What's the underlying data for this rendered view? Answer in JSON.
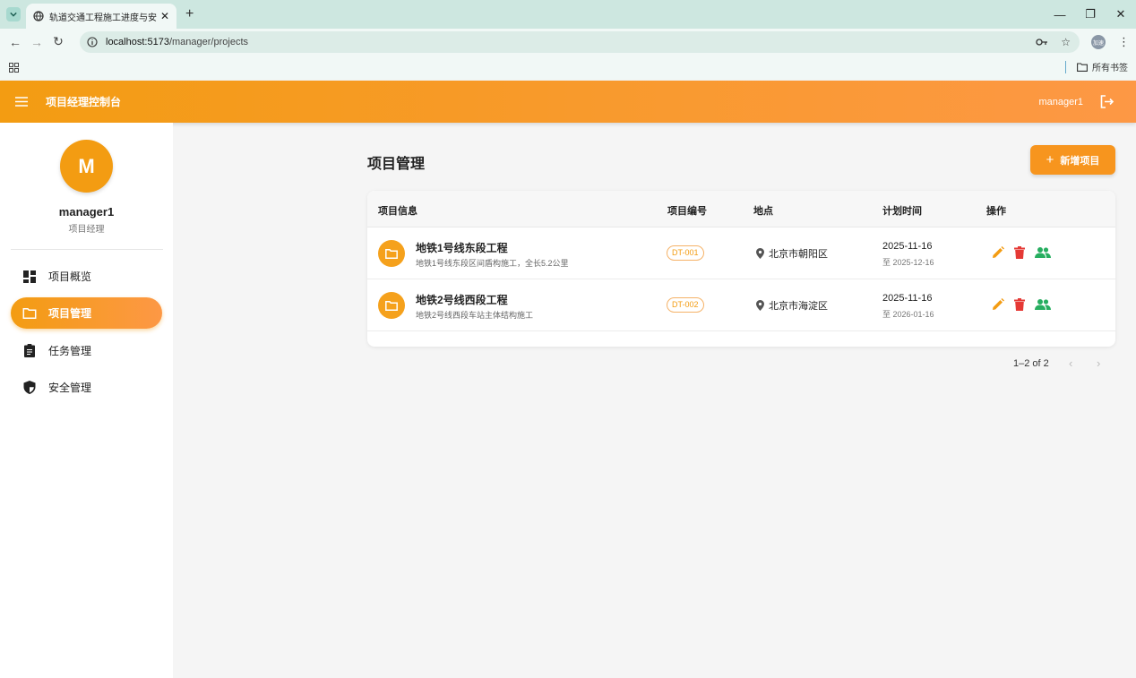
{
  "browser": {
    "tab_title": "轨道交通工程施工进度与安全信",
    "url_host": "localhost:5173",
    "url_path": "/manager/projects",
    "profile_label": "加速",
    "bookmarks_label": "所有书签"
  },
  "appbar": {
    "title": "项目经理控制台",
    "username": "manager1"
  },
  "sidebar": {
    "avatar_letter": "M",
    "username": "manager1",
    "role": "项目经理",
    "items": [
      {
        "label": "项目概览",
        "icon": "dashboard-icon",
        "active": false
      },
      {
        "label": "项目管理",
        "icon": "folder-icon",
        "active": true
      },
      {
        "label": "任务管理",
        "icon": "assignment-icon",
        "active": false
      },
      {
        "label": "安全管理",
        "icon": "shield-icon",
        "active": false
      }
    ]
  },
  "main": {
    "page_title": "项目管理",
    "add_button_label": "新增项目",
    "table": {
      "headers": {
        "info": "项目信息",
        "code": "项目编号",
        "location": "地点",
        "schedule": "计划时间",
        "actions": "操作"
      },
      "rows": [
        {
          "name": "地铁1号线东段工程",
          "desc": "地铁1号线东段区间盾构施工，全长5.2公里",
          "code": "DT-001",
          "location": "北京市朝阳区",
          "start": "2025-11-16",
          "end": "至 2025-12-16"
        },
        {
          "name": "地铁2号线西段工程",
          "desc": "地铁2号线西段车站主体结构施工",
          "code": "DT-002",
          "location": "北京市海淀区",
          "start": "2025-11-16",
          "end": "至 2026-01-16"
        }
      ]
    },
    "pagination": "1–2 of 2"
  },
  "colors": {
    "accent": "#f39c12",
    "edit": "#f39c12",
    "delete": "#e53935",
    "members": "#27ae60"
  }
}
